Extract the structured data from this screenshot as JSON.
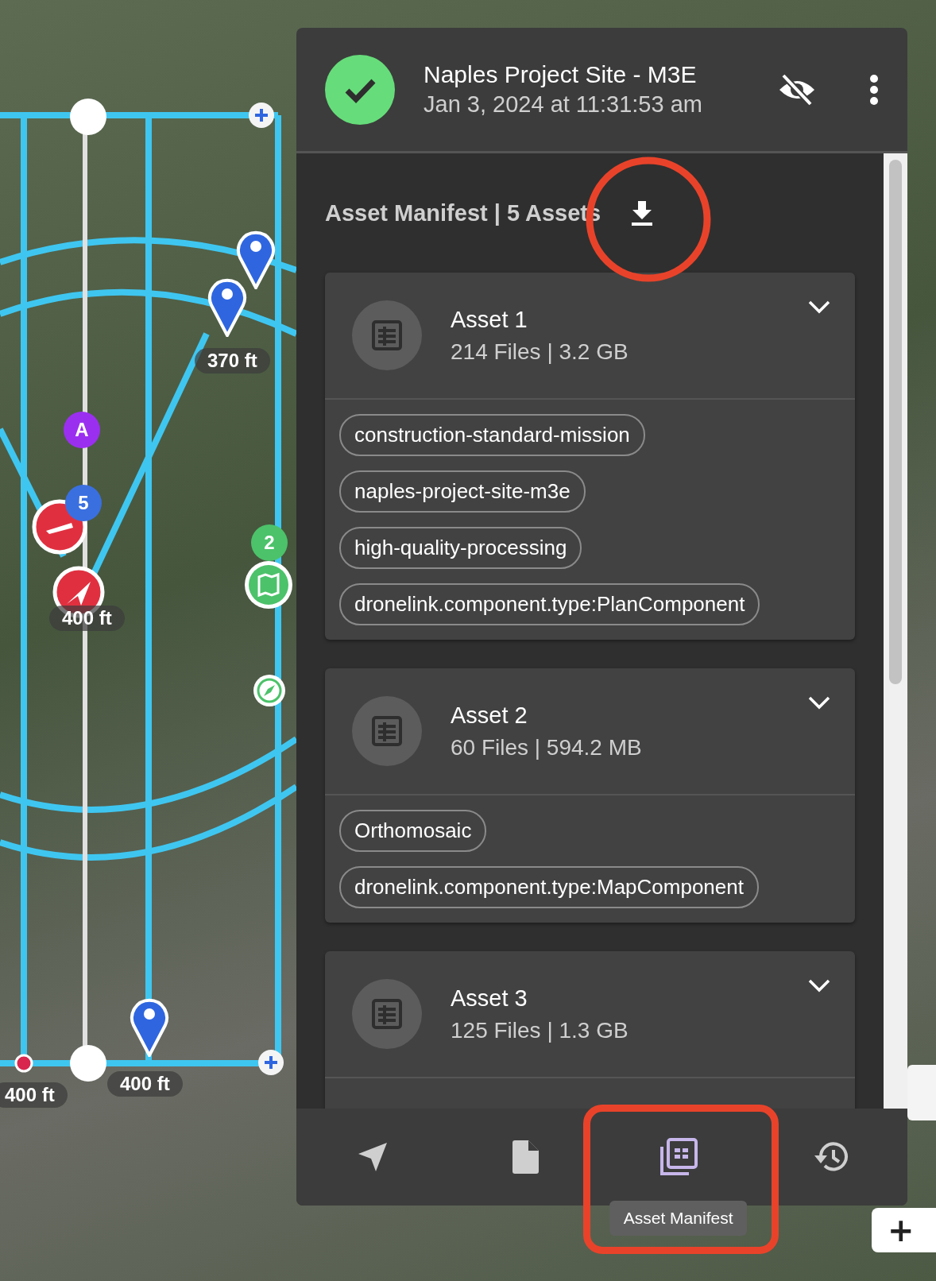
{
  "map": {
    "labels": [
      {
        "text": "370 ft"
      },
      {
        "text": "400 ft"
      },
      {
        "text": "400 ft"
      },
      {
        "text": "400 ft"
      }
    ],
    "badges": [
      {
        "text": "A",
        "color": "#9b2ff0"
      },
      {
        "text": "5",
        "color": "#3a6fe0"
      },
      {
        "text": "2",
        "color": "#4cc26a"
      }
    ],
    "zoom_in": "+"
  },
  "panel": {
    "completed": true,
    "title": "Naples Project Site - M3E",
    "subtitle": "Jan 3, 2024 at 11:31:53 am",
    "visible": false,
    "heading": "Asset Manifest | 5 Assets",
    "assets": [
      {
        "name": "Asset 1",
        "details": "214 Files | 3.2 GB",
        "expanded": false,
        "tags": [
          "construction-standard-mission",
          "naples-project-site-m3e",
          "high-quality-processing",
          "dronelink.component.type:PlanComponent"
        ]
      },
      {
        "name": "Asset 2",
        "details": "60 Files | 594.2 MB",
        "expanded": false,
        "tags": [
          "Orthomosaic",
          "dronelink.component.type:MapComponent"
        ]
      },
      {
        "name": "Asset 3",
        "details": "125 Files | 1.3 GB",
        "expanded": false
      }
    ],
    "nav": [
      {
        "kind": "mission",
        "selected": false
      },
      {
        "kind": "file",
        "selected": false
      },
      {
        "kind": "manifest",
        "selected": true,
        "tooltip": "Asset Manifest"
      },
      {
        "kind": "history",
        "selected": false
      }
    ]
  }
}
